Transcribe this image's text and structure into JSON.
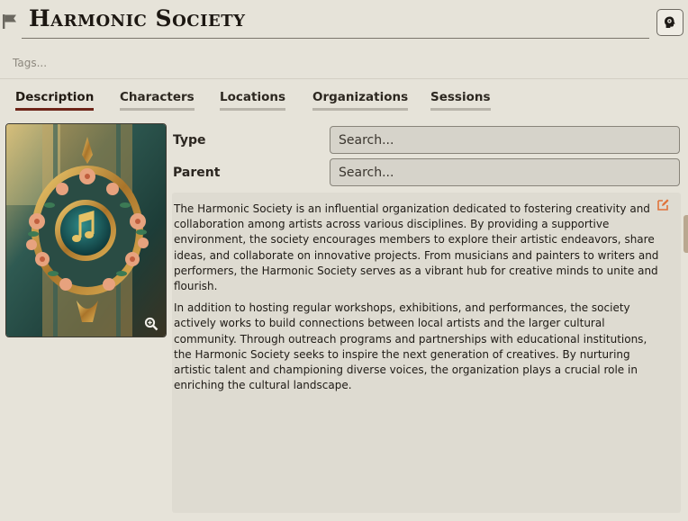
{
  "header": {
    "title": "Harmonic Society"
  },
  "tags": {
    "placeholder": "Tags..."
  },
  "tabs": [
    {
      "label": "Description",
      "active": true
    },
    {
      "label": "Characters",
      "active": false
    },
    {
      "label": "Locations",
      "active": false
    },
    {
      "label": "Organizations",
      "active": false
    },
    {
      "label": "Sessions",
      "active": false
    }
  ],
  "fields": {
    "type": {
      "label": "Type",
      "placeholder": "Search...",
      "value": ""
    },
    "parent": {
      "label": "Parent",
      "placeholder": "Search...",
      "value": ""
    }
  },
  "description": {
    "paragraphs": [
      "The Harmonic Society is an influential organization dedicated to fostering creativity and collaboration among artists across various disciplines. By providing a supportive environment, the society encourages members to explore their artistic endeavors, share ideas, and collaborate on innovative projects. From musicians and painters to writers and performers, the Harmonic Society serves as a vibrant hub for creative minds to unite and flourish.",
      "In addition to hosting regular workshops, exhibitions, and performances, the society actively works to build connections between local artists and the larger cultural community. Through outreach programs and partnerships with educational institutions, the Harmonic Society seeks to inspire the next generation of creatives. By nurturing artistic talent and championing diverse voices, the organization plays a crucial role in enriching the cultural landscape."
    ]
  },
  "icons": {
    "flag": "flag-icon",
    "brain": "brain-icon",
    "zoom": "zoom-in-icon",
    "edit": "edit-icon"
  },
  "colors": {
    "background": "#e6e3d9",
    "active_tab_underline": "#6d2418",
    "edit_icon": "#e0733a"
  }
}
